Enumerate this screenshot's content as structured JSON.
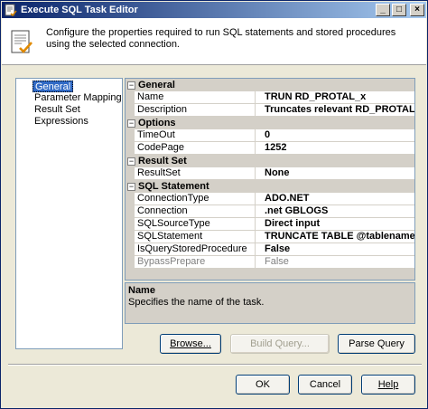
{
  "window": {
    "title": "Execute SQL Task Editor"
  },
  "title_buttons": {
    "minimize": "_",
    "maximize": "□",
    "close": "×"
  },
  "header": {
    "description": "Configure the properties required to run SQL statements and stored procedures using the selected connection."
  },
  "nav": {
    "items": [
      {
        "label": "General",
        "selected": true
      },
      {
        "label": "Parameter Mapping",
        "selected": false
      },
      {
        "label": "Result Set",
        "selected": false
      },
      {
        "label": "Expressions",
        "selected": false
      }
    ]
  },
  "grid": {
    "toggle_symbol": "−",
    "categories": [
      {
        "label": "General",
        "props": [
          {
            "name": "Name",
            "value": "TRUN RD_PROTAL_x"
          },
          {
            "name": "Description",
            "value": "Truncates relevant RD_PROTAL-tab"
          }
        ]
      },
      {
        "label": "Options",
        "props": [
          {
            "name": "TimeOut",
            "value": "0"
          },
          {
            "name": "CodePage",
            "value": "1252"
          }
        ]
      },
      {
        "label": "Result Set",
        "props": [
          {
            "name": "ResultSet",
            "value": "None"
          }
        ]
      },
      {
        "label": "SQL Statement",
        "props": [
          {
            "name": "ConnectionType",
            "value": "ADO.NET"
          },
          {
            "name": "Connection",
            "value": ".net GBLOGS"
          },
          {
            "name": "SQLSourceType",
            "value": "Direct input"
          },
          {
            "name": "SQLStatement",
            "value": "TRUNCATE TABLE @tablename"
          },
          {
            "name": "IsQueryStoredProcedure",
            "value": "False"
          },
          {
            "name": "BypassPrepare",
            "value": "False",
            "disabled": true
          }
        ]
      }
    ]
  },
  "help": {
    "title": "Name",
    "text": "Specifies the name of the task."
  },
  "buttons": {
    "browse": "Browse...",
    "build_query": "Build Query...",
    "parse_query": "Parse Query",
    "ok": "OK",
    "cancel": "Cancel",
    "help": "Help"
  }
}
